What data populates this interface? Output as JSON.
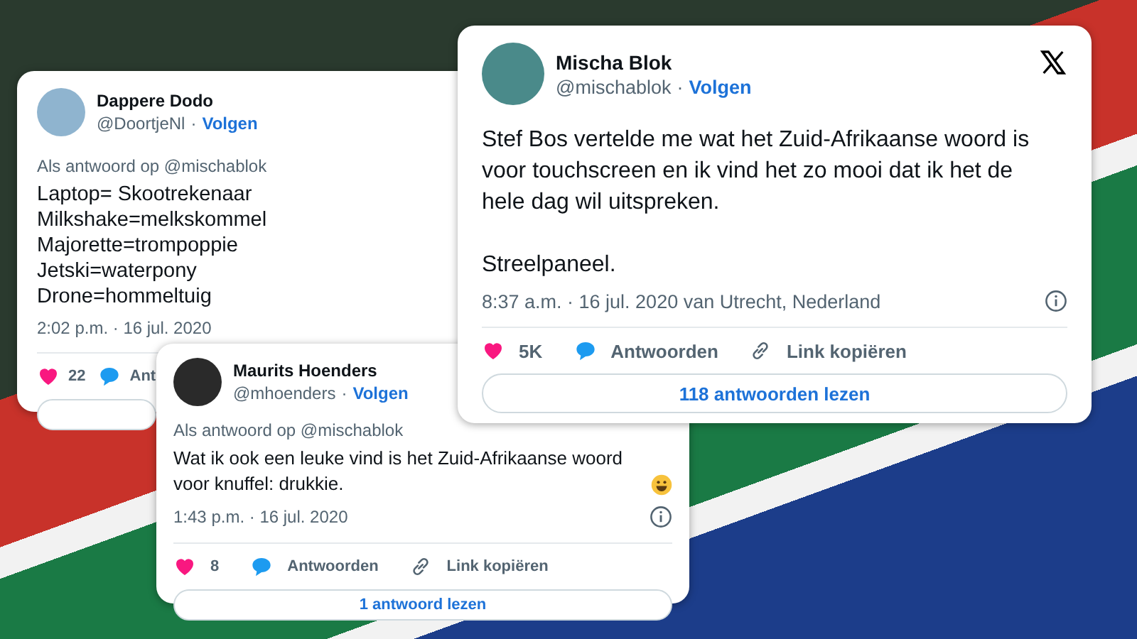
{
  "tweets": [
    {
      "name": "Dappere Dodo",
      "handle": "@DoortjeNl",
      "follow": "Volgen",
      "reply_to": "Als antwoord op @mischablok",
      "text": "Laptop= Skootrekenaar\nMilkshake=melkskommel\nMajorette=trompoppie\nJetski=waterpony\nDrone=hommeltuig",
      "timestamp": "2:02 p.m. · 16 jul. 2020",
      "likes": "22",
      "reply_label": "Ant",
      "separator": "·"
    },
    {
      "name": "Mischa Blok",
      "handle": "@mischablok",
      "follow": "Volgen",
      "show_logo": true,
      "text": "Stef Bos vertelde me wat het Zuid-Afrikaanse woord is voor touchscreen en ik vind het zo mooi dat ik het de hele dag wil uitspreken.\n\nStreelpaneel.",
      "timestamp": "8:37 a.m. · 16 jul. 2020 van Utrecht, Nederland",
      "show_info": true,
      "likes": "5K",
      "reply_label": "Antwoorden",
      "link_label": "Link kopiëren",
      "read_button": "118 antwoorden lezen",
      "separator": "·"
    },
    {
      "name": "Maurits Hoenders",
      "handle": "@mhoenders",
      "follow": "Volgen",
      "reply_to": "Als antwoord op @mischablok",
      "text": "Wat ik ook een leuke vind is het Zuid-Afrikaanse woord voor knuffel: drukkie.",
      "emoji": true,
      "timestamp": "1:43 p.m. · 16 jul. 2020",
      "show_info": true,
      "likes": "8",
      "reply_label": "Antwoorden",
      "link_label": "Link kopiëren",
      "read_button": "1 antwoord lezen",
      "separator": "·"
    }
  ]
}
